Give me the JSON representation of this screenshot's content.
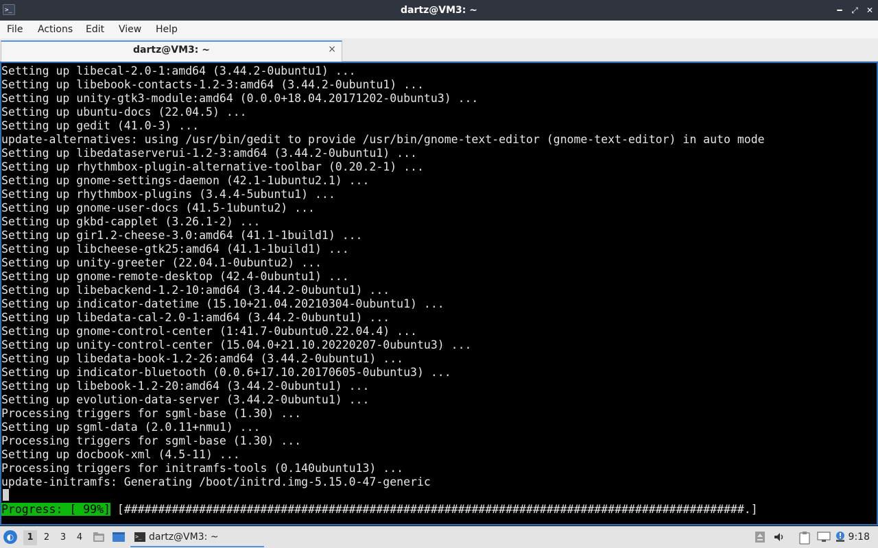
{
  "window": {
    "title": "dartz@VM3: ~",
    "app_icon_glyph": ">_",
    "minimize_glyph": "━",
    "maximize_glyph": "⤢",
    "close_glyph": "✕"
  },
  "menu": {
    "items": [
      "File",
      "Actions",
      "Edit",
      "View",
      "Help"
    ]
  },
  "tab": {
    "label": "dartz@VM3: ~",
    "close_glyph": "×"
  },
  "terminal": {
    "lines": [
      "Setting up libecal-2.0-1:amd64 (3.44.2-0ubuntu1) ...",
      "Setting up libebook-contacts-1.2-3:amd64 (3.44.2-0ubuntu1) ...",
      "Setting up unity-gtk3-module:amd64 (0.0.0+18.04.20171202-0ubuntu3) ...",
      "Setting up ubuntu-docs (22.04.5) ...",
      "Setting up gedit (41.0-3) ...",
      "update-alternatives: using /usr/bin/gedit to provide /usr/bin/gnome-text-editor (gnome-text-editor) in auto mode",
      "Setting up libedataserverui-1.2-3:amd64 (3.44.2-0ubuntu1) ...",
      "Setting up rhythmbox-plugin-alternative-toolbar (0.20.2-1) ...",
      "Setting up gnome-settings-daemon (42.1-1ubuntu2.1) ...",
      "Setting up rhythmbox-plugins (3.4.4-5ubuntu1) ...",
      "Setting up gnome-user-docs (41.5-1ubuntu2) ...",
      "Setting up gkbd-capplet (3.26.1-2) ...",
      "Setting up gir1.2-cheese-3.0:amd64 (41.1-1build1) ...",
      "Setting up libcheese-gtk25:amd64 (41.1-1build1) ...",
      "Setting up unity-greeter (22.04.1-0ubuntu2) ...",
      "Setting up gnome-remote-desktop (42.4-0ubuntu1) ...",
      "Setting up libebackend-1.2-10:amd64 (3.44.2-0ubuntu1) ...",
      "Setting up indicator-datetime (15.10+21.04.20210304-0ubuntu1) ...",
      "Setting up libedata-cal-2.0-1:amd64 (3.44.2-0ubuntu1) ...",
      "Setting up gnome-control-center (1:41.7-0ubuntu0.22.04.4) ...",
      "Setting up unity-control-center (15.04.0+21.10.20220207-0ubuntu3) ...",
      "Setting up libedata-book-1.2-26:amd64 (3.44.2-0ubuntu1) ...",
      "Setting up indicator-bluetooth (0.0.6+17.10.20170605-0ubuntu3) ...",
      "Setting up libebook-1.2-20:amd64 (3.44.2-0ubuntu1) ...",
      "Setting up evolution-data-server (3.44.2-0ubuntu1) ...",
      "Processing triggers for sgml-base (1.30) ...",
      "Setting up sgml-data (2.0.11+nmu1) ...",
      "Processing triggers for sgml-base (1.30) ...",
      "Setting up docbook-xml (4.5-11) ...",
      "Processing triggers for initramfs-tools (0.140ubuntu13) ...",
      "update-initramfs: Generating /boot/initrd.img-5.15.0-47-generic"
    ],
    "progress_label": "Progress: [ 99%]",
    "progress_bar": " [###########################################################################################.] ",
    "progress_value": 0.99
  },
  "taskbar": {
    "workspaces": [
      "1",
      "2",
      "3",
      "4"
    ],
    "active_workspace": "1",
    "task_label": "dartz@VM3: ~",
    "clock": "9:18",
    "icons": {
      "start": "lubuntu-logo-icon",
      "files": "file-manager-icon",
      "desktop": "show-desktop-icon"
    }
  }
}
